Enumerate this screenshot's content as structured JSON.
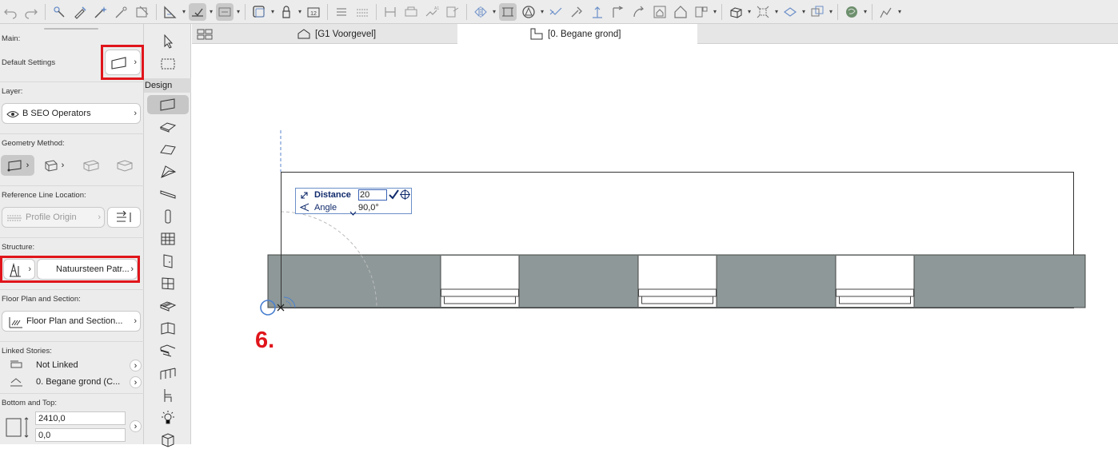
{
  "toolbar": {
    "icons": [
      "undo-icon",
      "redo-icon",
      "pick-up-parameters-icon",
      "inject-parameters-icon",
      "magic-wand-icon",
      "trace-icon",
      "transform-icon",
      "guide-lines-icon",
      "snap-guides-icon",
      "suspend-groups-icon",
      "layer-combinations-icon",
      "pen-set-icon",
      "scale-icon",
      "renovation-filter-icon",
      "structural-function-icon",
      "dimension-icon",
      "level-dimension-icon",
      "text-icon",
      "label-icon",
      "mirror-icon",
      "offset-icon",
      "split-icon",
      "adjust-icon",
      "intersect-icon",
      "fillet-icon",
      "elevate-icon",
      "crop-icon",
      "roof-icon",
      "wall-end-icon",
      "3d-view-icon",
      "layers-icon",
      "explode-icon",
      "duplicate-icon",
      "publish-icon",
      "bimcloud-icon"
    ]
  },
  "left_panel": {
    "main_label": "Main:",
    "default_settings_label": "Default Settings",
    "layer_label": "Layer:",
    "layer_value": "B SEO Operators",
    "geometry_label": "Geometry Method:",
    "ref_line_label": "Reference Line Location:",
    "ref_line_value": "Profile Origin",
    "structure_label": "Structure:",
    "structure_value": "Natuursteen Patr...",
    "floor_plan_label": "Floor Plan and Section:",
    "floor_plan_value": "Floor Plan and Section...",
    "linked_stories_label": "Linked Stories:",
    "linked_top": "Not Linked",
    "linked_bottom": "0. Begane grond (C...",
    "bottom_top_label": "Bottom and Top:",
    "height_value": "2410,0",
    "offset_value": "0,0"
  },
  "toolbox": {
    "design_label": "Design"
  },
  "tabs": [
    {
      "label": "[G1 Voorgevel]",
      "icon": "elevation-icon",
      "active": false
    },
    {
      "label": "[0. Begane grond]",
      "icon": "floor-plan-icon",
      "active": true
    }
  ],
  "tracker": {
    "distance_label": "Distance",
    "distance_value": "20",
    "angle_label": "Angle",
    "angle_value": "90,0°"
  },
  "annotation": {
    "step": "6."
  },
  "colors": {
    "highlight": "#e0151b",
    "wall_fill": "#8e9898",
    "tracker_border": "#6b8fc9"
  }
}
